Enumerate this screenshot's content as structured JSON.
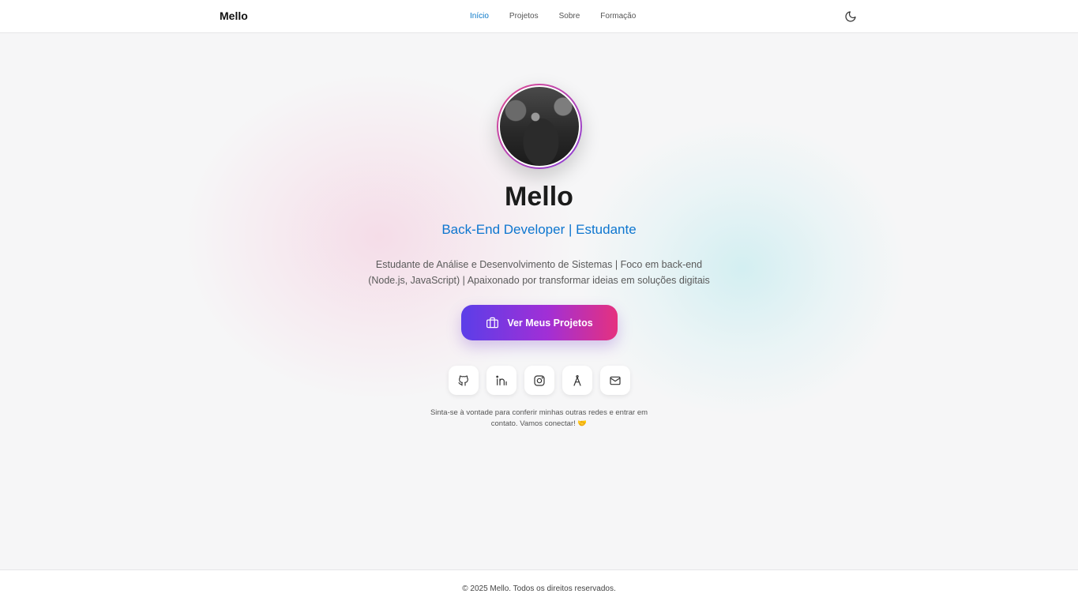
{
  "header": {
    "brand": "Mello",
    "nav": [
      {
        "label": "Início",
        "active": true
      },
      {
        "label": "Projetos",
        "active": false
      },
      {
        "label": "Sobre",
        "active": false
      },
      {
        "label": "Formação",
        "active": false
      }
    ],
    "theme_toggle_icon": "moon-icon"
  },
  "hero": {
    "avatar_icon": "profile-photo",
    "name": "Mello",
    "role": "Back-End Developer | Estudante",
    "description": "Estudante de Análise e Desenvolvimento de Sistemas | Foco em back-end (Node.js, JavaScript) | Apaixonado por transformar ideias em soluções digitais",
    "cta_label": "Ver Meus Projetos",
    "cta_icon": "briefcase-icon",
    "socials": [
      {
        "icon": "github-icon"
      },
      {
        "icon": "linkedin-icon"
      },
      {
        "icon": "instagram-icon"
      },
      {
        "icon": "compass-icon"
      },
      {
        "icon": "mail-icon"
      }
    ],
    "invite_text": "Sinta-se à vontade para conferir minhas outras redes e entrar em contato. Vamos conectar! 🤝"
  },
  "footer": {
    "text": "© 2025 Mello. Todos os direitos reservados."
  },
  "colors": {
    "accent": "#0d76cf",
    "cta_start": "#5b3ee8",
    "cta_end": "#e5317f",
    "background": "#f6f6f7"
  }
}
